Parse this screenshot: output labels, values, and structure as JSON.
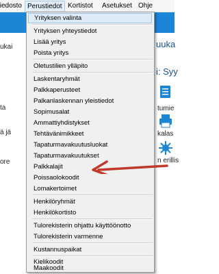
{
  "menubar": {
    "items": [
      {
        "label": "Tiedosto",
        "active": false
      },
      {
        "label": "Perustiedot",
        "active": true
      },
      {
        "label": "Kortistot",
        "active": false
      },
      {
        "label": "Asetukset",
        "active": false
      },
      {
        "label": "Ohje",
        "active": false
      }
    ]
  },
  "background": {
    "left_fragments": [
      "ukai",
      "ta",
      "ä jä",
      "ore"
    ],
    "right_title_fragments": [
      "uuka",
      "i: Syy"
    ],
    "right_fragments": [
      "tumie",
      "kalas",
      "n erillis"
    ]
  },
  "menu": {
    "groups": [
      [
        "Yrityksen valinta"
      ],
      [
        "Yrityksen yhteystiedot",
        "Lisää yritys",
        "Poista yritys"
      ],
      [
        "Oletustilien ylläpito"
      ],
      [
        "Laskentaryhmät",
        "Palkkaperusteet",
        "Palkanlaskennan yleistiedot",
        "Sopimusalat",
        "Ammattiyhdistykset",
        "Tehtävänimikkeet",
        "Tapaturmavakuutusluokat",
        "Tapaturmavakuutukset",
        "Palkkalajit",
        "Poissaolokoodit",
        "Lomakertoimet"
      ],
      [
        "Henkilöryhmät",
        "Henkilökortisto"
      ],
      [
        "Tulorekisterin ohjattu käyttöönotto",
        "Tulorekisterin varmenne"
      ],
      [
        "Kustannuspaikat"
      ],
      [
        "Kielikoodit",
        "Maakoodit"
      ]
    ],
    "highlighted": "Yrityksen valinta"
  },
  "annotation": {
    "arrow_color": "#c0392b",
    "points_to": "Poissaolokoodit"
  }
}
